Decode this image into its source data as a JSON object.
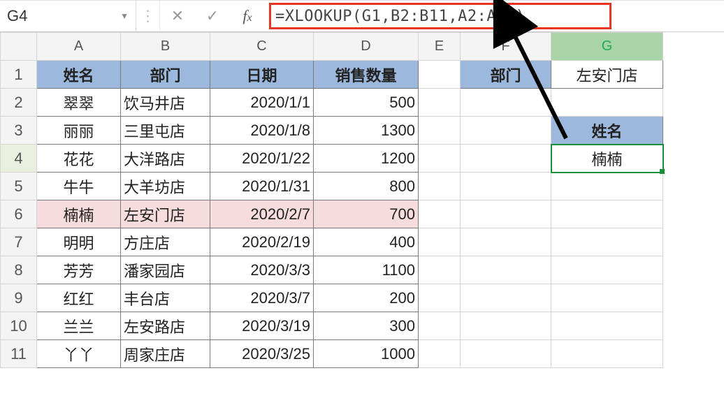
{
  "formula_bar": {
    "name_box": "G4",
    "formula": "=XLOOKUP(G1,B2:B11,A2:A11)"
  },
  "column_headers": [
    "A",
    "B",
    "C",
    "D",
    "E",
    "F",
    "G"
  ],
  "row_headers": [
    "1",
    "2",
    "3",
    "4",
    "5",
    "6",
    "7",
    "8",
    "9",
    "10",
    "11"
  ],
  "table_headers": {
    "A": "姓名",
    "B": "部门",
    "C": "日期",
    "D": "销售数量"
  },
  "table_rows": [
    {
      "name": "翠翠",
      "dept": "饮马井店",
      "date": "2020/1/1",
      "qty": "500"
    },
    {
      "name": "丽丽",
      "dept": "三里屯店",
      "date": "2020/1/8",
      "qty": "1300"
    },
    {
      "name": "花花",
      "dept": "大洋路店",
      "date": "2020/1/22",
      "qty": "1200"
    },
    {
      "name": "牛牛",
      "dept": "大羊坊店",
      "date": "2020/1/31",
      "qty": "800"
    },
    {
      "name": "楠楠",
      "dept": "左安门店",
      "date": "2020/2/7",
      "qty": "700"
    },
    {
      "name": "明明",
      "dept": "方庄店",
      "date": "2020/2/19",
      "qty": "400"
    },
    {
      "name": "芳芳",
      "dept": "潘家园店",
      "date": "2020/3/3",
      "qty": "1100"
    },
    {
      "name": "红红",
      "dept": "丰台店",
      "date": "2020/3/7",
      "qty": "200"
    },
    {
      "name": "兰兰",
      "dept": "左安路店",
      "date": "2020/3/19",
      "qty": "300"
    },
    {
      "name": "丫丫",
      "dept": "周家庄店",
      "date": "2020/3/25",
      "qty": "1000"
    }
  ],
  "lookup_panel": {
    "dept_label": "部门",
    "dept_value": "左安门店",
    "name_label": "姓名",
    "name_value": "楠楠"
  },
  "selected_cell": "G4",
  "highlighted_row": 6
}
